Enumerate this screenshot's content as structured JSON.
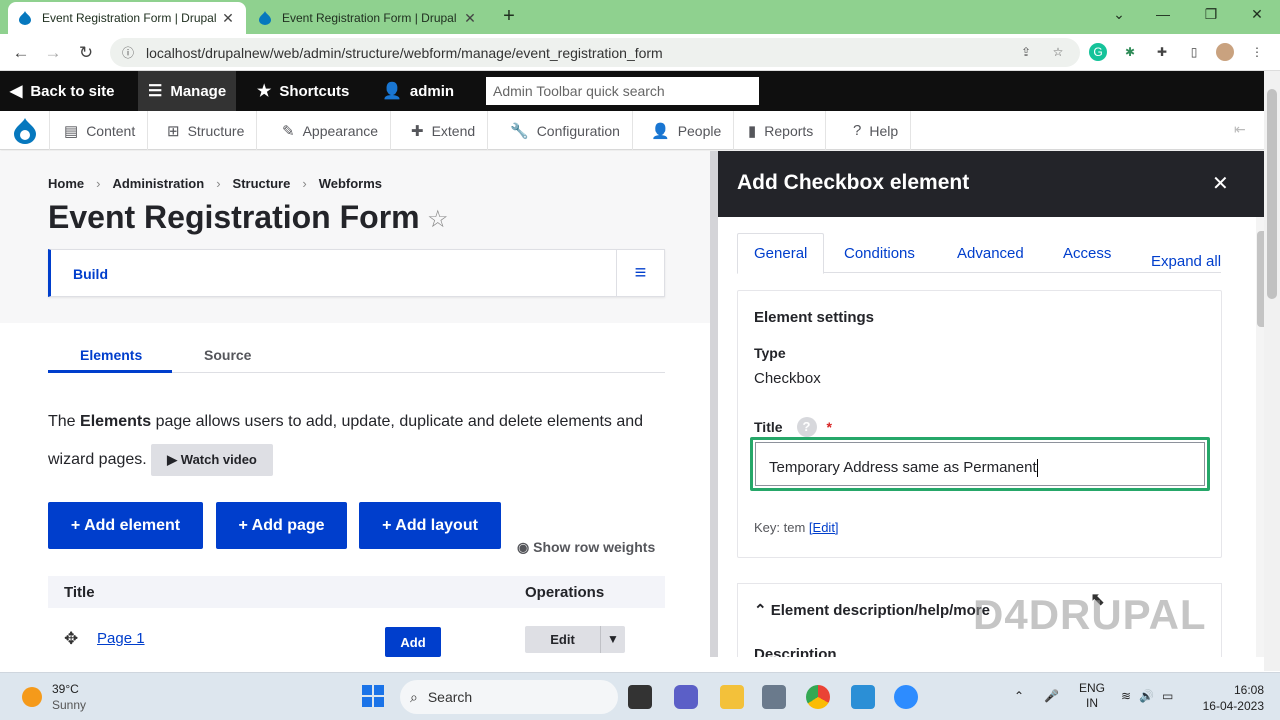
{
  "browser": {
    "tabs": [
      {
        "title": "Event Registration Form | Drupal",
        "active": true
      },
      {
        "title": "Event Registration Form | Drupal",
        "active": false
      }
    ],
    "new_tab": "+",
    "url": "localhost/drupalnew/web/admin/structure/webform/manage/event_registration_form"
  },
  "toolbar": {
    "back": "Back to site",
    "manage": "Manage",
    "shortcuts": "Shortcuts",
    "user": "admin",
    "search_placeholder": "Admin Toolbar quick search"
  },
  "tray": {
    "items": [
      "Content",
      "Structure",
      "Appearance",
      "Extend",
      "Configuration",
      "People",
      "Reports",
      "Help"
    ]
  },
  "page": {
    "breadcrumb": [
      "Home",
      "Administration",
      "Structure",
      "Webforms"
    ],
    "title": "Event Registration Form",
    "build_tab": "Build",
    "subtabs": [
      "Elements",
      "Source"
    ],
    "intro_prefix": "The ",
    "intro_bold": "Elements",
    "intro_rest": " page allows users to add, update, duplicate and delete elements and wizard pages.",
    "watch_video": "▶ Watch video",
    "buttons": [
      "+ Add element",
      "+ Add page",
      "+ Add layout"
    ],
    "row_weights": "Show row weights",
    "table": {
      "col_title": "Title",
      "col_ops": "Operations",
      "rows": [
        {
          "title": "Page 1",
          "add": "Add",
          "edit": "Edit"
        }
      ]
    }
  },
  "dialog": {
    "title": "Add Checkbox element",
    "tabs": [
      "General",
      "Conditions",
      "Advanced",
      "Access"
    ],
    "expand_all": "Expand all",
    "section": "Element settings",
    "type_label": "Type",
    "type_value": "Checkbox",
    "title_label": "Title",
    "title_help": "?",
    "title_required": "*",
    "title_value": "Temporary Address same as  Permanent",
    "key_prefix": "Key: tem ",
    "key_edit": "[Edit]",
    "desc_section": "Element description/help/more",
    "desc_label": "Description",
    "watermark": "D4DRUPAL"
  },
  "taskbar": {
    "temperature": "39°C",
    "condition": "Sunny",
    "search": "Search",
    "lang1": "ENG",
    "lang2": "IN",
    "time": "16:08",
    "date": "16-04-2023"
  },
  "colors": {
    "accent": "#003ecc",
    "toolbar": "#0f0f0f",
    "focus": "#26a769",
    "tabbar": "#8fd18f"
  }
}
